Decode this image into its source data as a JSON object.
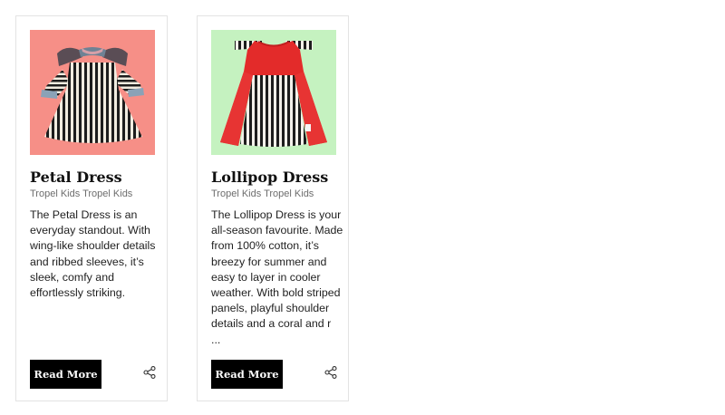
{
  "products": [
    {
      "title": "Petal Dress",
      "brand": "Tropel Kids Tropel Kids",
      "description": "The Petal Dress is an everyday standout. With wing-like shoulder details and ribbed sleeves, it’s sleek, comfy and effortlessly striking.",
      "button_label": "Read More",
      "image_bg": "#f68f87",
      "share_icon": "share-icon"
    },
    {
      "title": "Lollipop Dress",
      "brand": "Tropel Kids Tropel Kids",
      "description": "The Lollipop Dress is your all-season favourite. Made from 100% cotton, it’s breezy for summer and easy to layer in cooler weather. With bold striped panels, playful shoulder details and a coral and r ...",
      "button_label": "Read More",
      "image_bg": "#c5f2c0",
      "share_icon": "share-icon"
    }
  ]
}
